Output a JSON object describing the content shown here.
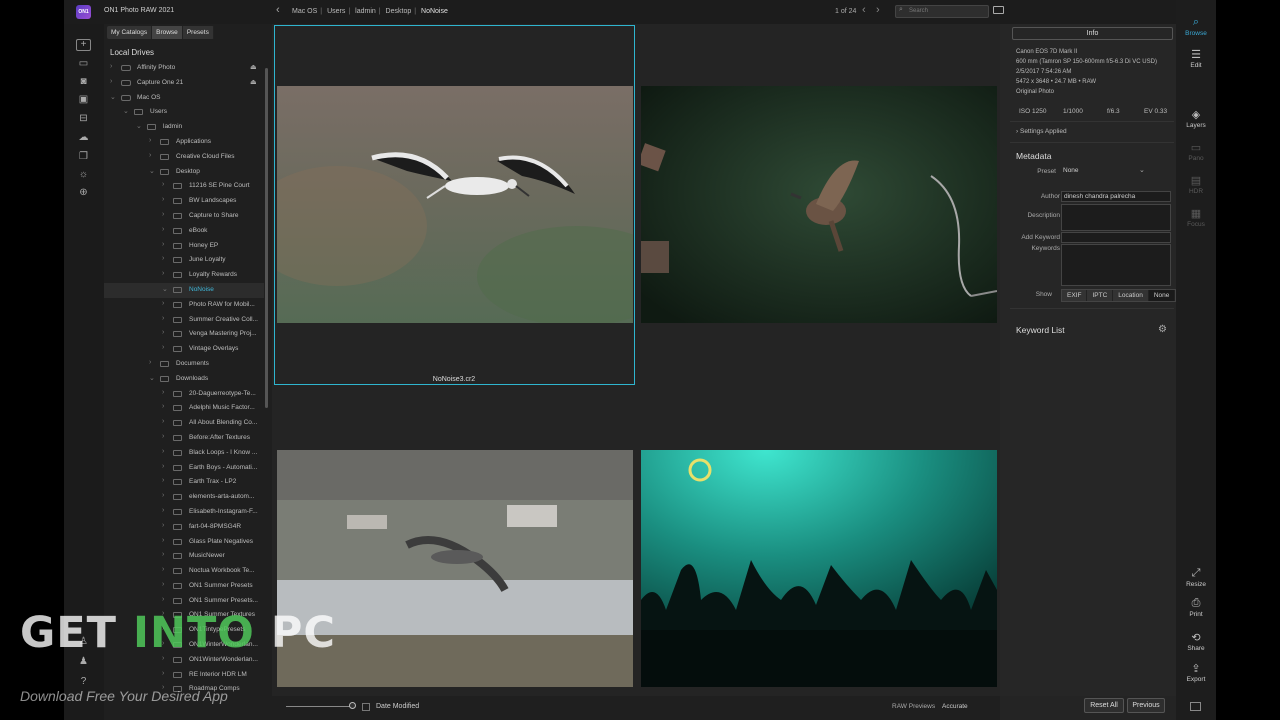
{
  "app": {
    "title": "ON1 Photo RAW 2021",
    "logo_text": "ON1"
  },
  "breadcrumb": [
    "Mac OS",
    "Users",
    "ladmin",
    "Desktop",
    "NoNoise"
  ],
  "pager": {
    "text": "1 of 24"
  },
  "search": {
    "placeholder": "Search"
  },
  "sidebar": {
    "tabs": [
      "My Catalogs",
      "Browse",
      "Presets"
    ],
    "active_tab": "Browse",
    "section_title": "Local Drives",
    "items": [
      {
        "label": "Affinity Photo",
        "depth": 0,
        "type": "drive",
        "eject": true
      },
      {
        "label": "Capture One 21",
        "depth": 0,
        "type": "drive",
        "eject": true
      },
      {
        "label": "Mac OS",
        "depth": 0,
        "type": "drive",
        "open": true
      },
      {
        "label": "Users",
        "depth": 1,
        "type": "folder",
        "open": true
      },
      {
        "label": "ladmin",
        "depth": 2,
        "type": "folder",
        "open": true
      },
      {
        "label": "Applications",
        "depth": 3,
        "type": "folder"
      },
      {
        "label": "Creative Cloud Files",
        "depth": 3,
        "type": "folder"
      },
      {
        "label": "Desktop",
        "depth": 3,
        "type": "folder",
        "open": true
      },
      {
        "label": "11216 SE Pine Court",
        "depth": 4,
        "type": "folder"
      },
      {
        "label": "BW Landscapes",
        "depth": 4,
        "type": "folder"
      },
      {
        "label": "Capture to Share",
        "depth": 4,
        "type": "folder"
      },
      {
        "label": "eBook",
        "depth": 4,
        "type": "folder"
      },
      {
        "label": "Honey EP",
        "depth": 4,
        "type": "folder"
      },
      {
        "label": "June Loyalty",
        "depth": 4,
        "type": "folder"
      },
      {
        "label": "Loyalty Rewards",
        "depth": 4,
        "type": "folder"
      },
      {
        "label": "NoNoise",
        "depth": 4,
        "type": "folder",
        "open": true,
        "selected": true
      },
      {
        "label": "Photo RAW for Mobil...",
        "depth": 4,
        "type": "folder"
      },
      {
        "label": "Summer Creative Coll...",
        "depth": 4,
        "type": "folder"
      },
      {
        "label": "Venga Mastering Proj...",
        "depth": 4,
        "type": "folder"
      },
      {
        "label": "Vintage Overlays",
        "depth": 4,
        "type": "folder"
      },
      {
        "label": "Documents",
        "depth": 3,
        "type": "folder"
      },
      {
        "label": "Downloads",
        "depth": 3,
        "type": "folder",
        "open": true
      },
      {
        "label": "20-Daguerreotype-Te...",
        "depth": 4,
        "type": "folder"
      },
      {
        "label": "Adelphi Music Factor...",
        "depth": 4,
        "type": "folder"
      },
      {
        "label": "All About Blending Co...",
        "depth": 4,
        "type": "folder"
      },
      {
        "label": "Before:After Textures",
        "depth": 4,
        "type": "folder"
      },
      {
        "label": "Black Loops - I Know ...",
        "depth": 4,
        "type": "folder"
      },
      {
        "label": "Earth Boys - Automati...",
        "depth": 4,
        "type": "folder"
      },
      {
        "label": "Earth Trax - LP2",
        "depth": 4,
        "type": "folder"
      },
      {
        "label": "elements-arta-autom...",
        "depth": 4,
        "type": "folder"
      },
      {
        "label": "Elisabeth-Instagram-F...",
        "depth": 4,
        "type": "folder"
      },
      {
        "label": "fart-04-8PMSG4R",
        "depth": 4,
        "type": "folder"
      },
      {
        "label": "Glass Plate Negatives",
        "depth": 4,
        "type": "folder"
      },
      {
        "label": "MusicNewer",
        "depth": 4,
        "type": "folder"
      },
      {
        "label": "Noctua Workbook Te...",
        "depth": 4,
        "type": "folder"
      },
      {
        "label": "ON1 Summer Presets",
        "depth": 4,
        "type": "folder"
      },
      {
        "label": "ON1 Summer Presets...",
        "depth": 4,
        "type": "folder"
      },
      {
        "label": "ON1 Summer Textures",
        "depth": 4,
        "type": "folder"
      },
      {
        "label": "ON1TintypePresets",
        "depth": 4,
        "type": "folder"
      },
      {
        "label": "ON1WinterWonderlan...",
        "depth": 4,
        "type": "folder"
      },
      {
        "label": "ON1WinterWonderlan...",
        "depth": 4,
        "type": "folder"
      },
      {
        "label": "RE Interior HDR LM",
        "depth": 4,
        "type": "folder"
      },
      {
        "label": "Roadmap Comps",
        "depth": 4,
        "type": "folder"
      }
    ]
  },
  "grid": {
    "selected_filename": "NoNoise3.cr2",
    "rating_stars": 0,
    "photos": [
      "stork-in-flight",
      "sparrow-in-flight",
      "heron-over-water",
      "concert-crowd"
    ]
  },
  "bottom": {
    "sort_label": "Date Modified",
    "raw_label": "RAW Previews",
    "raw_value": "Accurate"
  },
  "info": {
    "tab": "Info",
    "camera": "Canon EOS 7D Mark II",
    "lens": "600 mm (Tamron SP 150-600mm f/5-6.3 Di VC USD)",
    "datetime": "2/5/2017 7:54:26 AM",
    "size": "5472 x 3648 • 24.7 MB • RAW",
    "type": "Original Photo",
    "iso": "ISO 1250",
    "shutter": "1/1000",
    "aperture": "f/6.3",
    "ev": "EV 0.33",
    "settings_applied": "Settings Applied",
    "metadata_title": "Metadata",
    "preset_label": "Preset",
    "preset_value": "None",
    "author_label": "Author",
    "author_value": "dinesh chandra palrecha",
    "description_label": "Description",
    "add_keyword_label": "Add Keyword",
    "keywords_label": "Keywords",
    "show_label": "Show",
    "show_buttons": [
      "EXIF",
      "IPTC",
      "Location",
      "None"
    ],
    "show_active": "None",
    "keyword_list_title": "Keyword List"
  },
  "modules": [
    {
      "label": "Browse",
      "icon": "browse-icon",
      "state": "on"
    },
    {
      "label": "Edit",
      "icon": "sliders-icon",
      "state": "normal"
    },
    {
      "label": "Layers",
      "icon": "layers-icon",
      "state": "normal"
    },
    {
      "label": "Pano",
      "icon": "pano-icon",
      "state": "off"
    },
    {
      "label": "HDR",
      "icon": "hdr-icon",
      "state": "off"
    },
    {
      "label": "Focus",
      "icon": "focus-icon",
      "state": "off"
    },
    {
      "label": "Resize",
      "icon": "resize-icon",
      "state": "normal"
    },
    {
      "label": "Print",
      "icon": "print-icon",
      "state": "normal"
    },
    {
      "label": "Share",
      "icon": "share-icon",
      "state": "normal"
    },
    {
      "label": "Export",
      "icon": "export-icon",
      "state": "normal"
    }
  ],
  "buttons": {
    "reset_all": "Reset All",
    "previous": "Previous"
  },
  "watermark": {
    "line1_a": "GET ",
    "line1_b": "INTO",
    "line1_c": " PC",
    "line2": "Download Free Your Desired App"
  }
}
